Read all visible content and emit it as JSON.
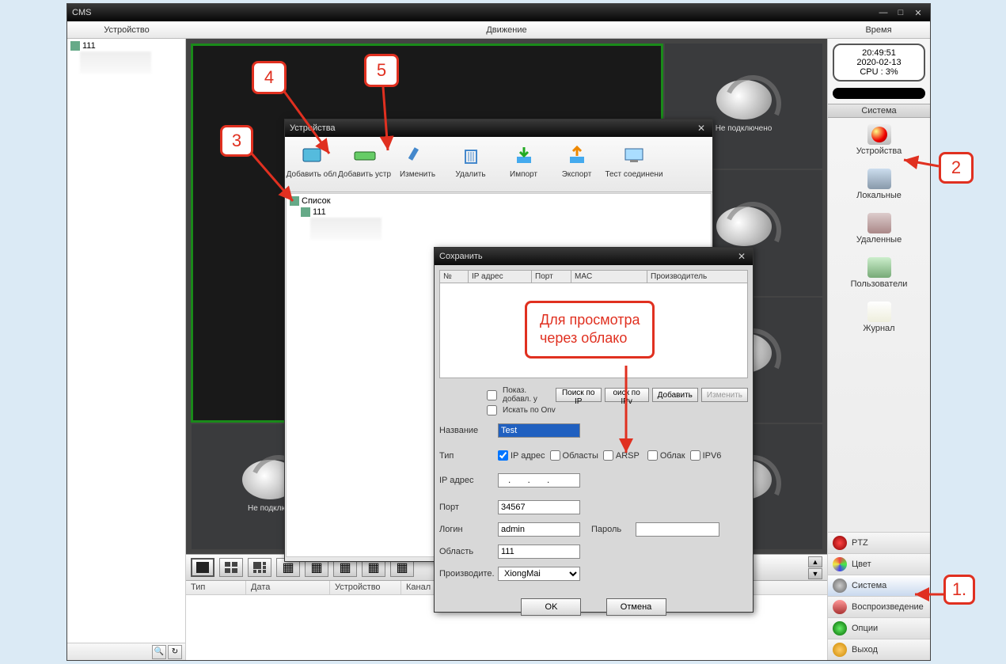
{
  "window": {
    "title": "CMS"
  },
  "menubar": {
    "left": "Устройство",
    "center": "Движение",
    "right": "Время"
  },
  "tree": {
    "root": "111"
  },
  "clock": {
    "time": "20:49:51",
    "date": "2020-02-13",
    "cpu": "CPU : 3%"
  },
  "system_panel": {
    "header": "Система",
    "items": [
      {
        "label": "Устройства"
      },
      {
        "label": "Локальные"
      },
      {
        "label": "Удаленные"
      },
      {
        "label": "Пользователи"
      },
      {
        "label": "Журнал"
      }
    ]
  },
  "right_menu": [
    {
      "label": "PTZ"
    },
    {
      "label": "Цвет"
    },
    {
      "label": "Система"
    },
    {
      "label": "Воспроизведение"
    },
    {
      "label": "Опции"
    },
    {
      "label": "Выход"
    }
  ],
  "not_connected": "Не подключено",
  "not_connected_cut1": "чено",
  "not_connected_cut2": "Не подключ",
  "log_columns": {
    "type": "Тип",
    "date": "Дата",
    "device": "Устройство",
    "channel": "Канал"
  },
  "dlg1": {
    "title": "Устройства",
    "toolbar": [
      {
        "label": "Добавить обл"
      },
      {
        "label": "Добавить устр"
      },
      {
        "label": "Изменить"
      },
      {
        "label": "Удалить"
      },
      {
        "label": "Импорт"
      },
      {
        "label": "Экспорт"
      },
      {
        "label": "Тест соединени"
      }
    ],
    "tree_root": "Список",
    "tree_child": "111"
  },
  "dlg2": {
    "title": "Сохранить",
    "columns": {
      "n": "№",
      "ip": "IP адрес",
      "port": "Порт",
      "mac": "MAC",
      "vendor": "Производитель"
    },
    "show_added": "Показ. добавл. у",
    "search_ip": "Поиск по IP",
    "search_ipv6": "оиск по IPv",
    "add": "Добавить",
    "edit": "Изменить",
    "search_onvif": "Искать по Onv",
    "labels": {
      "name": "Название",
      "type": "Тип",
      "ip": "IP адрес",
      "port": "Порт",
      "login": "Логин",
      "password": "Пароль",
      "area": "Область",
      "vendor": "Производите."
    },
    "type_opts": {
      "ip": "IP адрес",
      "domain": "Областы",
      "arsp": "ARSP",
      "cloud": "Облак",
      "ipv6": "IPV6"
    },
    "values": {
      "name": "Test",
      "ip": "   .       .       .",
      "port": "34567",
      "login": "admin",
      "area": "111",
      "vendor": "XiongMai"
    },
    "ok": "OK",
    "cancel": "Отмена"
  },
  "annotations": {
    "n1": "1.",
    "n2": "2",
    "n3": "3",
    "n4": "4",
    "n5": "5",
    "cloud_text": "Для просмотра\nчерез облако"
  }
}
